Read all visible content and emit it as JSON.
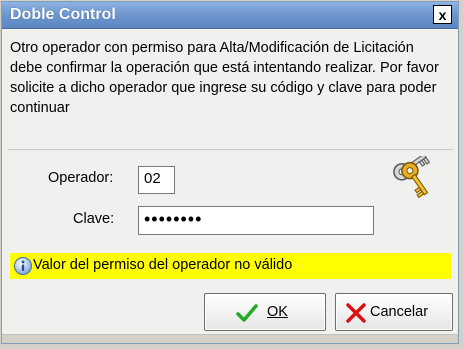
{
  "window": {
    "title": "Doble Control",
    "close_label": "x"
  },
  "message": "Otro operador con permiso para Alta/Modificación de Licitación debe confirmar la operación que está intentando realizar. Por favor solicite a dicho operador que ingrese su código y clave para poder continuar",
  "form": {
    "operador_label": "Operador:",
    "operador_value": "02",
    "clave_label": "Clave:",
    "clave_value": "••••••••"
  },
  "notice": {
    "text": "Valor del permiso del operador no válido",
    "background": "#ffff00"
  },
  "buttons": {
    "ok_label": "OK",
    "cancel_label": "Cancelar"
  },
  "icons": {
    "keys": "keys-icon",
    "info": "info-icon",
    "ok": "checkmark-icon",
    "cancel": "x-mark-icon",
    "close": "close-icon"
  },
  "colors": {
    "titlebar": "#6f98cf",
    "ok_check": "#22aa22",
    "cancel_x": "#dd1111"
  }
}
